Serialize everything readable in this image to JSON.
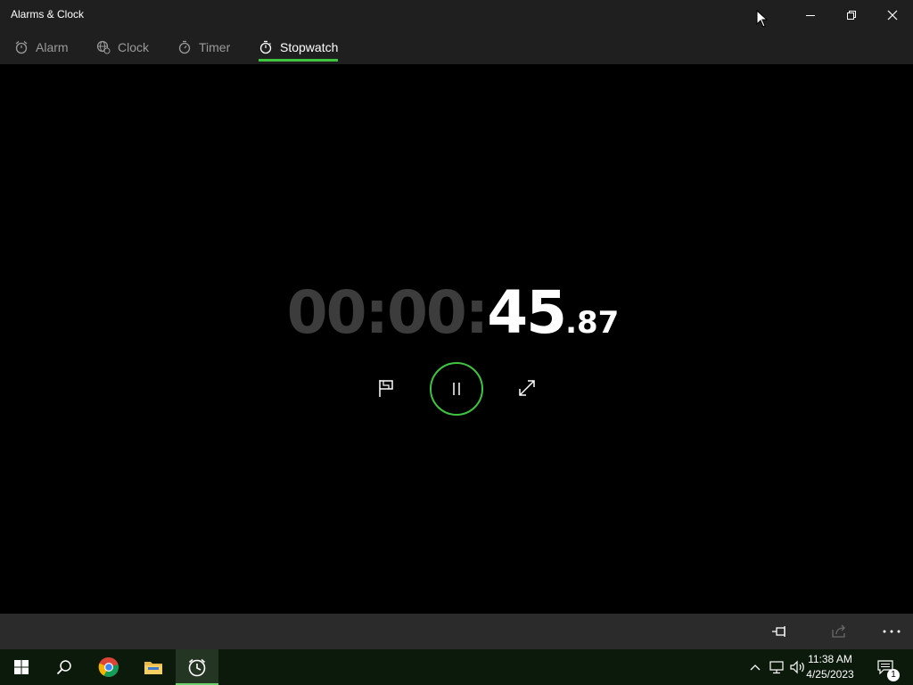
{
  "window": {
    "title": "Alarms & Clock"
  },
  "tabs": [
    {
      "label": "Alarm",
      "icon": "alarm-icon",
      "active": false
    },
    {
      "label": "Clock",
      "icon": "globe-clock-icon",
      "active": false
    },
    {
      "label": "Timer",
      "icon": "timer-icon",
      "active": false
    },
    {
      "label": "Stopwatch",
      "icon": "stopwatch-icon",
      "active": true
    }
  ],
  "stopwatch": {
    "hours": "00",
    "minutes": "00",
    "seconds": "45",
    "hundredths": "87",
    "controls": [
      "lap-flag-icon",
      "pause-icon",
      "expand-icon"
    ]
  },
  "command_bar": [
    "pin-icon",
    "share-icon",
    "more-icon"
  ],
  "taskbar": {
    "apps": [
      "start-icon",
      "search-icon",
      "chrome-icon",
      "file-explorer-icon",
      "alarms-app-icon"
    ],
    "time": "11:38 AM",
    "date": "4/25/2023",
    "notifications_count": "1"
  },
  "colors": {
    "accent": "#3fc43f",
    "background": "#000000",
    "chrome": "#1f1f1f",
    "dim_digits": "#3c3c3c"
  }
}
